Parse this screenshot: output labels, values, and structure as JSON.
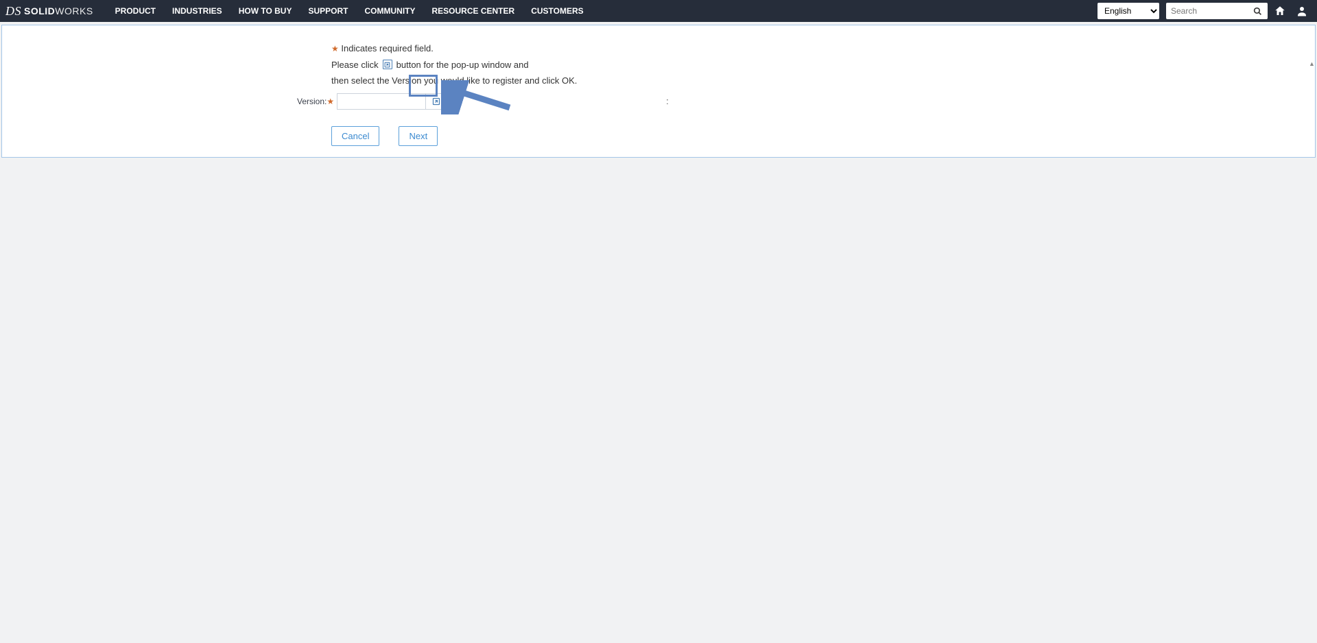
{
  "header": {
    "brand_prefix": "DS",
    "brand_bold": "SOLID",
    "brand_light": "WORKS",
    "nav": [
      "PRODUCT",
      "INDUSTRIES",
      "HOW TO BUY",
      "SUPPORT",
      "COMMUNITY",
      "RESOURCE CENTER",
      "CUSTOMERS"
    ],
    "language": "English",
    "search_placeholder": "Search"
  },
  "form": {
    "required_note": "Indicates required field.",
    "instruction_line1_a": "Please click",
    "instruction_line1_b": "button for the pop-up window and",
    "instruction_line2": "then select the Version you would like to register and click OK.",
    "version_label": "Version:",
    "version_value": "",
    "extra_colon": ":",
    "cancel": "Cancel",
    "next": "Next"
  }
}
